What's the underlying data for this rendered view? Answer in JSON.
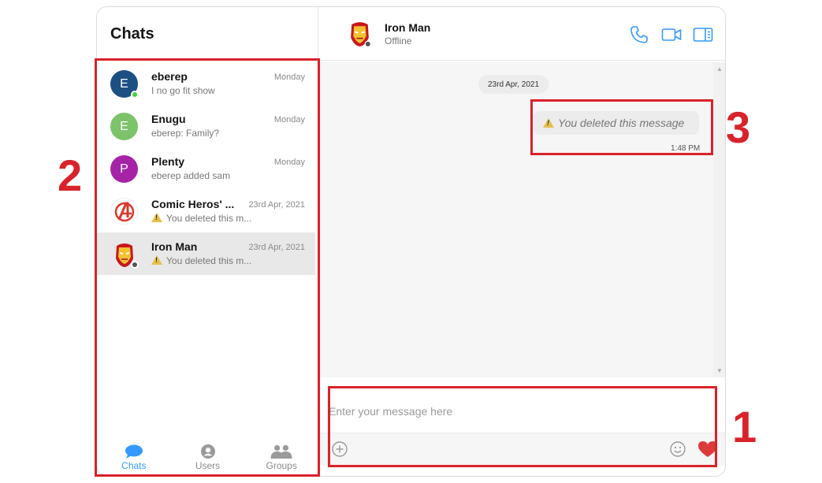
{
  "sidebar": {
    "title": "Chats",
    "chats": [
      {
        "initial": "E",
        "name": "eberep",
        "time": "Monday",
        "preview": "I no go fit show",
        "avatar_color": "#1d4f82",
        "presence": "online"
      },
      {
        "initial": "E",
        "name": "Enugu",
        "time": "Monday",
        "preview": "eberep: Family?",
        "avatar_color": "#7cc36a"
      },
      {
        "initial": "P",
        "name": "Plenty",
        "time": "Monday",
        "preview": "eberep added sam",
        "avatar_color": "#a423a7"
      },
      {
        "name": "Comic Heros' ...",
        "time": "23rd Apr, 2021",
        "preview": "You deleted this m...",
        "avatar_icon": "avengers-logo-icon"
      },
      {
        "name": "Iron Man",
        "time": "23rd Apr, 2021",
        "preview": "You deleted this m...",
        "avatar_icon": "iron-man-icon",
        "presence": "offline",
        "active": true
      }
    ],
    "nav": [
      {
        "label": "Chats",
        "icon": "chat-bubble-icon",
        "active": true
      },
      {
        "label": "Users",
        "icon": "user-icon"
      },
      {
        "label": "Groups",
        "icon": "group-icon"
      }
    ]
  },
  "conversation": {
    "name": "Iron Man",
    "status": "Offline",
    "date_separator": "23rd Apr, 2021",
    "message": {
      "text": "You deleted this message",
      "time": "1:48 PM"
    }
  },
  "composer": {
    "placeholder": "Enter your message here"
  },
  "annotations": [
    "1",
    "2",
    "3"
  ],
  "colors": {
    "accent": "#3399ff",
    "annotation": "#d9222a",
    "heart": "#de3a3a",
    "online": "#3cd23c",
    "offline": "#555555"
  }
}
